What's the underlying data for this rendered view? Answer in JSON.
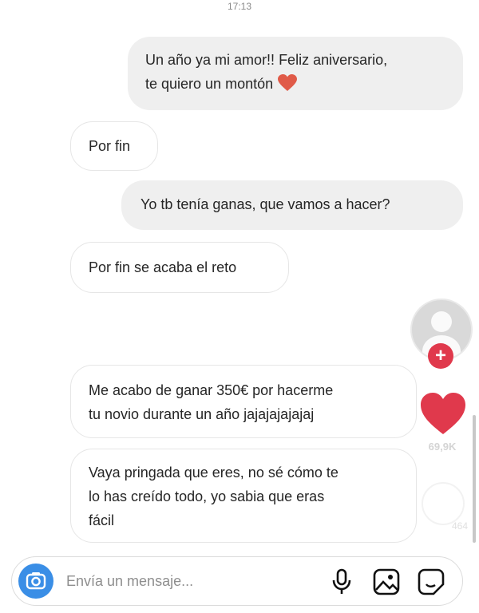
{
  "chat": {
    "timestamp": "17:13",
    "messages": [
      {
        "direction": "outgoing",
        "text": "Un año ya mi amor!! Feliz aniversario,\nte quiero un montón",
        "emoji": "red-heart"
      },
      {
        "direction": "incoming",
        "text": "Por fin"
      },
      {
        "direction": "outgoing",
        "text": "Yo tb tenía ganas, que vamos a hacer?"
      },
      {
        "direction": "incoming",
        "text": "Por fin se acaba el reto"
      },
      {
        "direction": "incoming",
        "text": "Me acabo de ganar 350€ por hacerme\ntu novio durante un año jajajajajajaj"
      },
      {
        "direction": "incoming",
        "text": "Vaya pringada que eres, no sé cómo te\nlo has creído todo, yo sabia que eras\nfácil"
      }
    ]
  },
  "overlay": {
    "plus_symbol": "+",
    "likes_count": "69,9K",
    "other_count": "464"
  },
  "composer": {
    "placeholder": "Envía un mensaje...",
    "value": "",
    "icons": [
      "camera-icon",
      "microphone-icon",
      "image-icon",
      "sticker-icon"
    ]
  },
  "colors": {
    "outgoing_bubble": "#efefef",
    "incoming_border": "#e6e6e6",
    "heart": "#e0394c",
    "camera": "#3a8ee6"
  }
}
